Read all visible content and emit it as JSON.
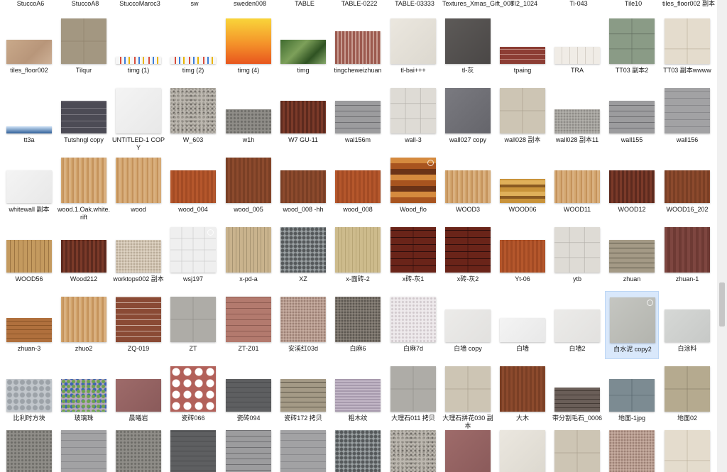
{
  "top_labels": [
    "StuccoA6",
    "StuccoA8",
    "StuccoMaroc3",
    "sw",
    "sweden008",
    "TABLE",
    "TABLE-0222",
    "TABLE-03333",
    "Textures_Xmas_Gift_008",
    "TI2_1024",
    "Ti-043",
    "Tile10",
    "tiles_floor002 副本"
  ],
  "rows": [
    [
      {
        "label": "tiles_floor002",
        "tex": "beige",
        "h": "s"
      },
      {
        "label": "Tilqur",
        "tex": "taupe",
        "h": "l"
      },
      {
        "label": "timg (1)",
        "tex": "figures",
        "h": "strip"
      },
      {
        "label": "timg (2)",
        "tex": "figures",
        "h": "strip"
      },
      {
        "label": "timg (4)",
        "tex": "sunset",
        "h": "l"
      },
      {
        "label": "timg",
        "tex": "green",
        "h": "s"
      },
      {
        "label": "tingcheweizhuan",
        "tex": "redgrid",
        "h": "m"
      },
      {
        "label": "tl-bai+++",
        "tex": "cream",
        "h": "l"
      },
      {
        "label": "tl-灰",
        "tex": "darkgray",
        "h": "l"
      },
      {
        "label": "tpaing",
        "tex": "brickred",
        "h": "xs"
      },
      {
        "label": "TRA",
        "tex": "lightstrip",
        "h": "xs"
      },
      {
        "label": "TT03 副本2",
        "tex": "greenstone",
        "h": "l"
      },
      {
        "label": "TT03 副本wwww",
        "tex": "lightstone",
        "h": "l"
      }
    ],
    [
      {
        "label": "tt3a",
        "tex": "sky",
        "h": "strip"
      },
      {
        "label": "Tutshngl copy",
        "tex": "shingle",
        "h": "m"
      },
      {
        "label": "UNTITLED-1 COPY",
        "tex": "white",
        "h": "l"
      },
      {
        "label": "W_603",
        "tex": "granite",
        "h": "l"
      },
      {
        "label": "w1h",
        "tex": "gravel",
        "h": "s"
      },
      {
        "label": "W7 GU-11",
        "tex": "darkwood",
        "h": "m"
      },
      {
        "label": "wal156m",
        "tex": "graybrick",
        "h": "m"
      },
      {
        "label": "wall-3",
        "tex": "lightgrid",
        "h": "l"
      },
      {
        "label": "wall027 copy",
        "tex": "slate",
        "h": "l"
      },
      {
        "label": "wall028 副本",
        "tex": "beigegrid",
        "h": "l"
      },
      {
        "label": "wall028 副本11",
        "tex": "smallstone",
        "h": "s"
      },
      {
        "label": "wall155",
        "tex": "graybrick",
        "h": "m"
      },
      {
        "label": "wall156",
        "tex": "graytile",
        "h": "l"
      }
    ],
    [
      {
        "label": "whitewall 副本",
        "tex": "white",
        "h": "m"
      },
      {
        "label": "wood.1.Oak.white.rift",
        "tex": "lightwood",
        "h": "l"
      },
      {
        "label": "wood",
        "tex": "lightwood",
        "h": "l"
      },
      {
        "label": "wood_004",
        "tex": "orangewood",
        "h": "m"
      },
      {
        "label": "wood_005",
        "tex": "brownwood",
        "h": "l"
      },
      {
        "label": "wood_008 -hh",
        "tex": "brownwood",
        "h": "m"
      },
      {
        "label": "wood_008",
        "tex": "orangewood",
        "h": "m"
      },
      {
        "label": "Wood_flo",
        "tex": "parquet",
        "h": "l"
      },
      {
        "label": "WOOD3",
        "tex": "lightwood",
        "h": "m"
      },
      {
        "label": "WOOD06",
        "tex": "mixwood",
        "h": "s"
      },
      {
        "label": "WOOD11",
        "tex": "lightwood",
        "h": "m"
      },
      {
        "label": "WOOD12",
        "tex": "darkwood",
        "h": "m"
      },
      {
        "label": "WOOD16_202",
        "tex": "brownwood",
        "h": "m"
      }
    ],
    [
      {
        "label": "WOOD56",
        "tex": "tanwood",
        "h": "m"
      },
      {
        "label": "Wood212",
        "tex": "darkwood",
        "h": "m"
      },
      {
        "label": "worktops002 副本",
        "tex": "speckle",
        "h": "m"
      },
      {
        "label": "wsj197",
        "tex": "whitetile",
        "h": "l"
      },
      {
        "label": "x-pd-a",
        "tex": "mosaic",
        "h": "l"
      },
      {
        "label": "XZ",
        "tex": "cobble",
        "h": "l"
      },
      {
        "label": "x-面砖-2",
        "tex": "tanstripe",
        "h": "l"
      },
      {
        "label": "x砖-灰1",
        "tex": "maroongrid",
        "h": "l"
      },
      {
        "label": "x砖-灰2",
        "tex": "maroongrid",
        "h": "l"
      },
      {
        "label": "Yt-06",
        "tex": "orangewood",
        "h": "m"
      },
      {
        "label": "ytb",
        "tex": "lightgrid",
        "h": "l"
      },
      {
        "label": "zhuan",
        "tex": "stonewall",
        "h": "m"
      },
      {
        "label": "zhuan-1",
        "tex": "maroon",
        "h": "l"
      }
    ],
    [
      {
        "label": "zhuan-3",
        "tex": "brickstrip",
        "h": "s"
      },
      {
        "label": "zhuo2",
        "tex": "lightwood",
        "h": "l"
      },
      {
        "label": "ZQ-019",
        "tex": "brick",
        "h": "l"
      },
      {
        "label": "ZT",
        "tex": "graygrid",
        "h": "l"
      },
      {
        "label": "ZT-Z01",
        "tex": "pinkbrick",
        "h": "l"
      },
      {
        "label": "安溪红03d",
        "tex": "pinkgranite",
        "h": "l"
      },
      {
        "label": "白麻6",
        "tex": "darkgranite",
        "h": "l"
      },
      {
        "label": "白麻7d",
        "tex": "whitegranite",
        "h": "l"
      },
      {
        "label": "白墙 copy",
        "tex": "offwhite",
        "h": "m"
      },
      {
        "label": "白墙",
        "tex": "white",
        "h": "s"
      },
      {
        "label": "白墙2",
        "tex": "offwhite",
        "h": "m"
      },
      {
        "label": "白水泥 copy2",
        "tex": "cement",
        "h": "l",
        "sel": true
      },
      {
        "label": "白涂料",
        "tex": "lightgray",
        "h": "m"
      }
    ],
    [
      {
        "label": "比利时方块",
        "tex": "hexgray",
        "h": "m"
      },
      {
        "label": "玻璃珠",
        "tex": "beads",
        "h": "m"
      },
      {
        "label": "晨曦岩",
        "tex": "mauve",
        "h": "m"
      },
      {
        "label": "瓷砖066",
        "tex": "octagon",
        "h": "l"
      },
      {
        "label": "瓷砖094",
        "tex": "darkgraystripe",
        "h": "m"
      },
      {
        "label": "瓷砖172 拷贝",
        "tex": "stonewall",
        "h": "m"
      },
      {
        "label": "粗木纹",
        "tex": "lilac",
        "h": "m"
      },
      {
        "label": "大理石011 拷贝",
        "tex": "graygrid",
        "h": "l"
      },
      {
        "label": "大理石拼花030 副本",
        "tex": "beigegrid",
        "h": "l"
      },
      {
        "label": "大木",
        "tex": "brownwood",
        "h": "l"
      },
      {
        "label": "带分割毛石_0006",
        "tex": "rubble",
        "h": "s"
      },
      {
        "label": "地面-1jpg",
        "tex": "pavers",
        "h": "m"
      },
      {
        "label": "地面02",
        "tex": "paverbeige",
        "h": "l"
      }
    ],
    [
      {
        "label": "",
        "tex": "gravel",
        "h": "l"
      },
      {
        "label": "",
        "tex": "graytile",
        "h": "l"
      },
      {
        "label": "",
        "tex": "gravel",
        "h": "l"
      },
      {
        "label": "",
        "tex": "darkgraystripe",
        "h": "l"
      },
      {
        "label": "",
        "tex": "graybrick",
        "h": "l"
      },
      {
        "label": "",
        "tex": "graytile",
        "h": "l"
      },
      {
        "label": "",
        "tex": "cobble",
        "h": "l"
      },
      {
        "label": "",
        "tex": "granite",
        "h": "l"
      },
      {
        "label": "",
        "tex": "mauve",
        "h": "l"
      },
      {
        "label": "",
        "tex": "cream",
        "h": "l"
      },
      {
        "label": "",
        "tex": "beigegrid",
        "h": "l"
      },
      {
        "label": "",
        "tex": "pinkgranite",
        "h": "l"
      },
      {
        "label": "",
        "tex": "lightstone",
        "h": "l"
      },
      {
        "label": "",
        "tex": "orangewood",
        "h": "l"
      }
    ]
  ],
  "badged": [
    "Wood_flo",
    "wsj197",
    "白水泥 copy2",
    "Tile10"
  ],
  "colors": {
    "selection": "#d9e8fb",
    "scrollbar": "#f0f0f0"
  }
}
